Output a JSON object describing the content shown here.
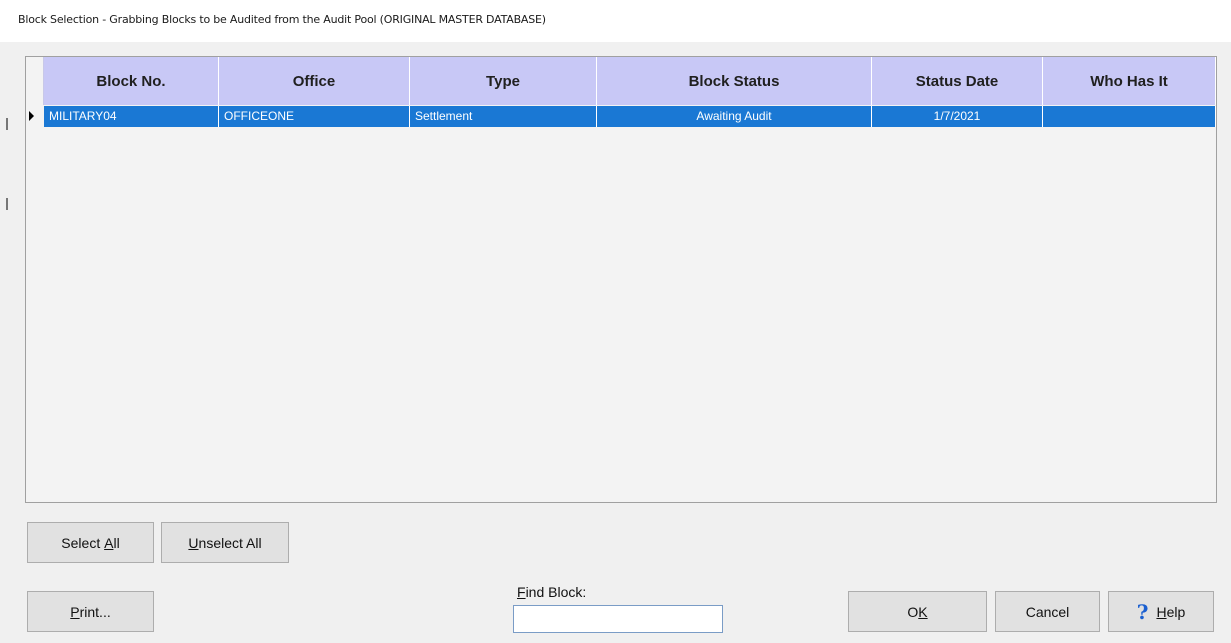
{
  "window": {
    "title": "Block Selection - Grabbing Blocks to be Audited from the Audit Pool (ORIGINAL MASTER DATABASE)"
  },
  "grid": {
    "columns": [
      "Block No.",
      "Office",
      "Type",
      "Block Status",
      "Status Date",
      "Who Has It"
    ],
    "rows": [
      {
        "block_no": "MILITARY04",
        "office": "OFFICEONE",
        "type": "Settlement",
        "block_status": "Awaiting Audit",
        "status_date": "1/7/2021",
        "who_has_it": "",
        "selected": true
      }
    ]
  },
  "buttons": {
    "select_all": {
      "pre": "Select ",
      "key": "A",
      "post": "ll"
    },
    "unselect_all": {
      "pre": "",
      "key": "U",
      "post": "nselect All"
    },
    "print": {
      "pre": "",
      "key": "P",
      "post": "rint..."
    },
    "ok": {
      "pre": "O",
      "key": "K",
      "post": ""
    },
    "cancel": {
      "label": "Cancel"
    },
    "help": {
      "pre": "",
      "key": "H",
      "post": "elp",
      "icon": "question-mark-icon"
    }
  },
  "find_block": {
    "label_key": "F",
    "label_rest": "ind Block:",
    "value": ""
  },
  "colors": {
    "header_bg": "#c8c8f6",
    "selected_row_bg": "#1a78d4",
    "help_icon": "#1a5fd0"
  }
}
